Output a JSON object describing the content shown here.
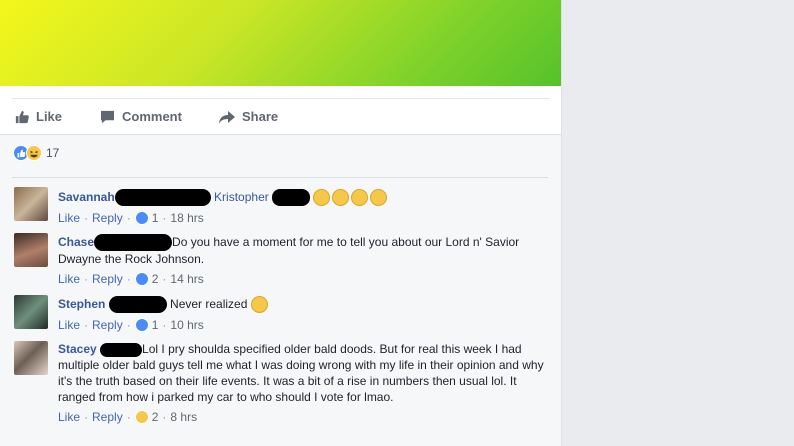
{
  "actions": {
    "like": "Like",
    "comment": "Comment",
    "share": "Share"
  },
  "reactions": {
    "count": "17"
  },
  "comments": [
    {
      "name": "Savannah",
      "tag": "Kristopher",
      "text": "",
      "like": "Like",
      "reply": "Reply",
      "likes": "1",
      "time": "18 hrs"
    },
    {
      "name": "Chase",
      "text": "Do you have a moment for me to tell you about our Lord n' Savior Dwayne the Rock Johnson.",
      "like": "Like",
      "reply": "Reply",
      "likes": "2",
      "time": "14 hrs"
    },
    {
      "name": "Stephen",
      "text": "Never realized",
      "like": "Like",
      "reply": "Reply",
      "likes": "1",
      "time": "10 hrs"
    },
    {
      "name": "Stacey",
      "text": "Lol I pry shoulda specified older bald doods. But for real this week I had multiple older bald guys tell me what I was doing wrong with my life in their opinion and why it's the truth based on their life events. It was a bit of a rise in numbers then usual lol. It ranged from how i parked my car to who should I vote for lmao.",
      "like": "Like",
      "reply": "Reply",
      "likes": "2",
      "time": "8 hrs"
    }
  ],
  "colors": {
    "link": "#385898",
    "like_blue": "#4a8cf7",
    "haha_yellow": "#f7c74a"
  }
}
